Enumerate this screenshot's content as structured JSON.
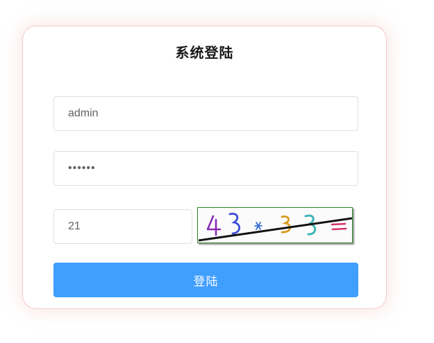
{
  "login": {
    "title": "系统登陆",
    "username": {
      "value": "admin"
    },
    "password": {
      "value": "••••••"
    },
    "captcha": {
      "value": "21",
      "image_text": "43*33="
    },
    "submit_label": "登陆"
  },
  "colors": {
    "primary": "#409eff",
    "card_border": "#f3c9c9",
    "captcha_border": "#2b8a2b"
  }
}
